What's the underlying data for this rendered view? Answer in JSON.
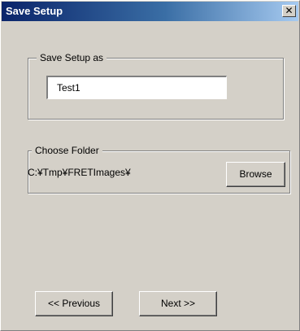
{
  "window": {
    "title": "Save Setup",
    "close_glyph": "✕",
    "close_icon": "close-icon"
  },
  "save_group": {
    "legend": "Save Setup as",
    "input_value": "Test1"
  },
  "folder_group": {
    "legend": "Choose Folder",
    "path": "C:¥Tmp¥FRETImages¥",
    "browse_label": "Browse"
  },
  "nav": {
    "previous_label": "<< Previous",
    "next_label": "Next >>"
  },
  "colors": {
    "window_face": "#d4d0c8",
    "titlebar_start": "#0a246a",
    "titlebar_end": "#a6caf0",
    "title_text": "#ffffff"
  }
}
